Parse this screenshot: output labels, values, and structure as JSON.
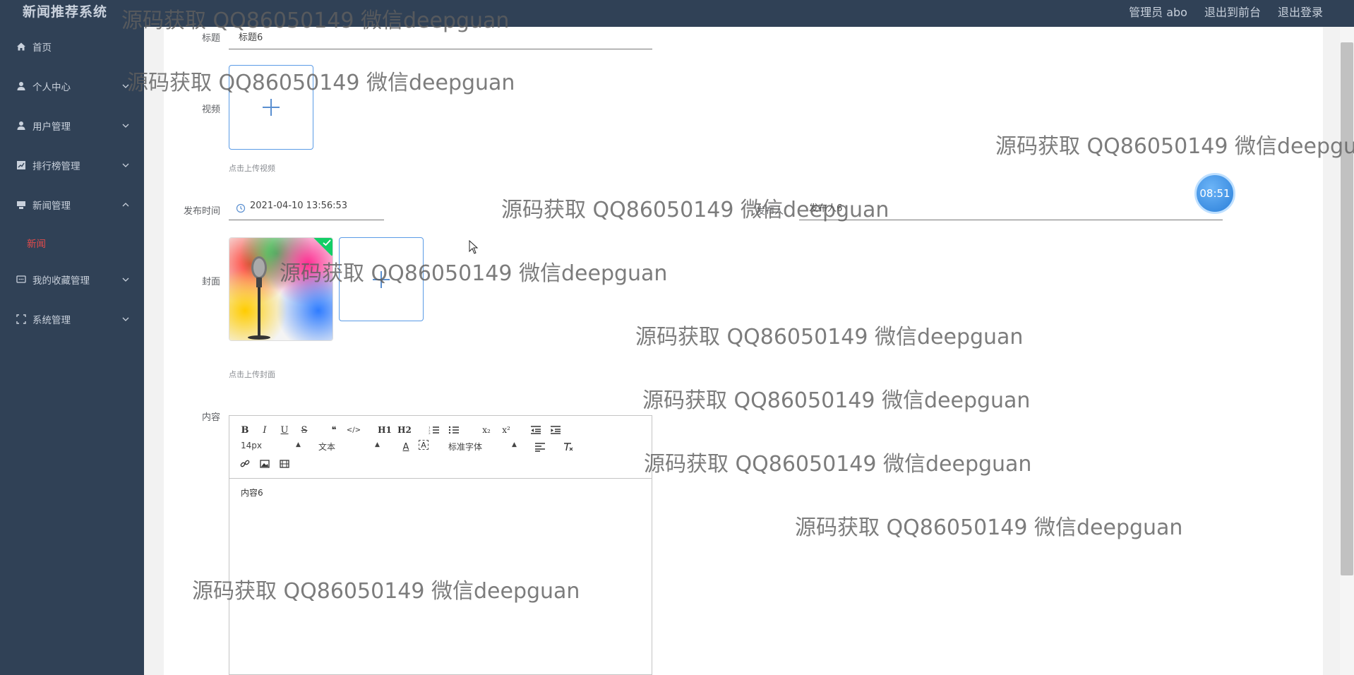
{
  "app": {
    "title": "新闻推荐系统"
  },
  "topbar": {
    "links": [
      "管理员 abo",
      "退出到前台",
      "退出登录"
    ]
  },
  "sidebar": {
    "items": [
      {
        "label": "首页",
        "icon": "home-icon"
      },
      {
        "label": "个人中心",
        "icon": "user-icon"
      },
      {
        "label": "用户管理",
        "icon": "user-icon"
      },
      {
        "label": "排行榜管理",
        "icon": "chart-icon"
      },
      {
        "label": "新闻管理",
        "icon": "news-icon"
      },
      {
        "label": "我的收藏管理",
        "icon": "chat-icon"
      },
      {
        "label": "系统管理",
        "icon": "fullscreen-icon"
      }
    ],
    "active_sub": "新闻"
  },
  "form": {
    "title_label": "标题",
    "title_value": "标题6",
    "video_label": "视频",
    "video_hint": "点击上传视频",
    "publish_label": "发布时间",
    "publish_value": "2021-04-10 13:56:53",
    "author_label": "发布人",
    "author_value": "发布人6",
    "cover_label": "封面",
    "cover_hint": "点击上传封面",
    "content_label": "内容",
    "content_value": "内容6"
  },
  "editor": {
    "buttons_row1": [
      "B",
      "I",
      "U",
      "S",
      "❝",
      "</>",
      "H1",
      "H2",
      "ol",
      "ul",
      "x₂",
      "x²",
      "outdent",
      "indent"
    ],
    "font_size": "14px",
    "text_type": "文本",
    "font_family": "标准字体"
  },
  "timer": "08:51",
  "watermark": "源码获取 QQ86050149 微信deepguan",
  "colors": {
    "sidebar": "#304156",
    "accent": "#5a9be6",
    "active": "#e34b4b"
  }
}
